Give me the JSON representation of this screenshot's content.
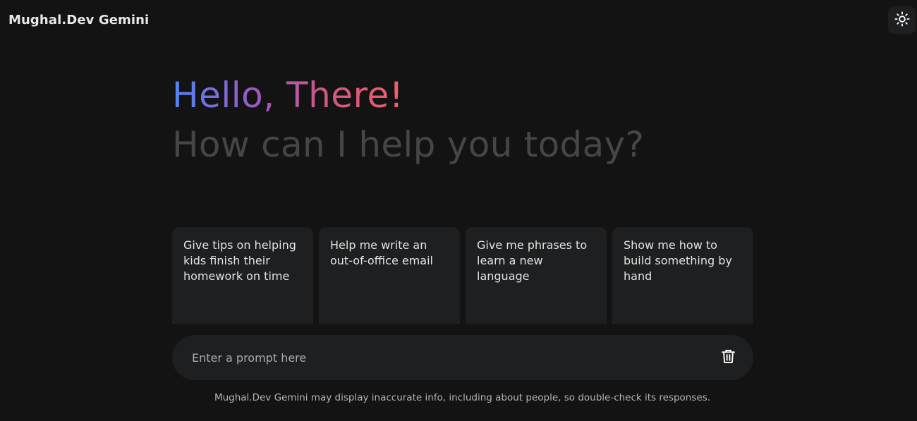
{
  "header": {
    "brand": "Mughal.Dev Gemini",
    "theme_toggle_icon": "sun-icon"
  },
  "hero": {
    "greeting": "Hello, There!",
    "subtitle": "How can I help you today?"
  },
  "suggestions": [
    {
      "text": "Give tips on helping kids finish their homework on time"
    },
    {
      "text": "Help me write an out-of-office email"
    },
    {
      "text": "Give me phrases to learn a new language"
    },
    {
      "text": "Show me how to build something by hand"
    }
  ],
  "prompt": {
    "placeholder": "Enter a prompt here",
    "value": "",
    "delete_icon": "trash-icon"
  },
  "footer": {
    "disclaimer": "Mughal.Dev Gemini may display inaccurate info, including about people, so double-check its responses."
  },
  "colors": {
    "background": "#131314",
    "surface": "#1e1f20",
    "muted_text": "#444746",
    "gradient_start": "#4f86f7",
    "gradient_end": "#f0606a"
  }
}
